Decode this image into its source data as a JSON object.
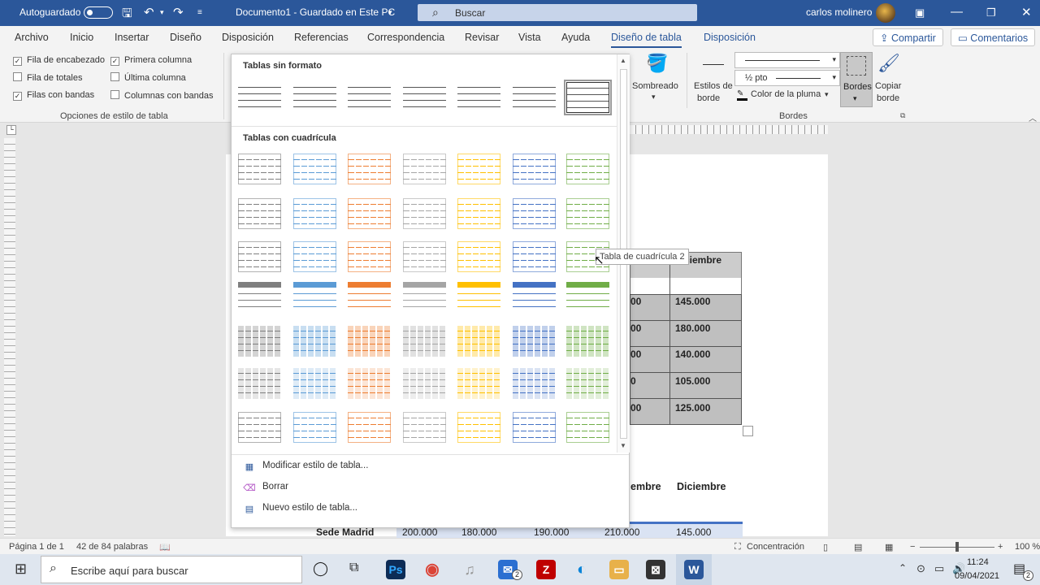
{
  "titlebar": {
    "autosave": "Autoguardado",
    "doc_title": "Documento1 - Guardado en Este PC",
    "search_placeholder": "Buscar",
    "user": "carlos molinero"
  },
  "tabs": [
    "Archivo",
    "Inicio",
    "Insertar",
    "Diseño",
    "Disposición",
    "Referencias",
    "Correspondencia",
    "Revisar",
    "Vista",
    "Ayuda",
    "Diseño de tabla",
    "Disposición"
  ],
  "share": {
    "compartir": "Compartir",
    "comentarios": "Comentarios"
  },
  "style_options": {
    "items": [
      {
        "label": "Fila de encabezado",
        "checked": true
      },
      {
        "label": "Primera columna",
        "checked": true
      },
      {
        "label": "Fila de totales",
        "checked": false
      },
      {
        "label": "Última columna",
        "checked": false
      },
      {
        "label": "Filas con bandas",
        "checked": true
      },
      {
        "label": "Columnas con bandas",
        "checked": false
      }
    ],
    "group_label": "Opciones de estilo de tabla"
  },
  "ribbon_right": {
    "sombreado": "Sombreado",
    "estilos1": "Estilos de",
    "estilos2": "borde",
    "pen_width": "½ pto",
    "pen_color": "Color de la pluma",
    "bordes": "Bordes",
    "copiar1": "Copiar",
    "copiar2": "borde",
    "group_bordes": "Bordes"
  },
  "gallery": {
    "header_plain": "Tablas sin formato",
    "header_grid": "Tablas con cuadrícula",
    "menu": [
      {
        "label": "Modificar estilo de tabla...",
        "icon": "modify-style-icon"
      },
      {
        "label": "Borrar",
        "icon": "eraser-icon"
      },
      {
        "label": "Nuevo estilo de tabla...",
        "icon": "new-table-style-icon"
      }
    ],
    "grid_colors": [
      "#7f7f7f",
      "#5b9bd5",
      "#ed7d31",
      "#a5a5a5",
      "#ffc000",
      "#4472c4",
      "#70ad47"
    ]
  },
  "tooltip": "Tabla de cuadrícula 2",
  "doc_table": {
    "header": "Diciembre",
    "values": [
      "145.000",
      "180.000",
      "140.000",
      "105.000",
      "125.000"
    ],
    "partials": [
      "00",
      "00",
      "00",
      "0",
      "00"
    ]
  },
  "doc_table2": {
    "header_partial": "embre",
    "header": "Diciembre",
    "row": [
      "Sede Madrid",
      "200.000",
      "180.000",
      "190.000",
      "210.000",
      "145.000"
    ]
  },
  "status": {
    "pages": "Página 1 de 1",
    "words": "42 de 84 palabras",
    "focus": "Concentración",
    "zoom": "100 %"
  },
  "taskbar": {
    "search_placeholder": "Escribe aquí para buscar",
    "time": "11:24",
    "date": "09/04/2021",
    "notif_count": "2"
  }
}
